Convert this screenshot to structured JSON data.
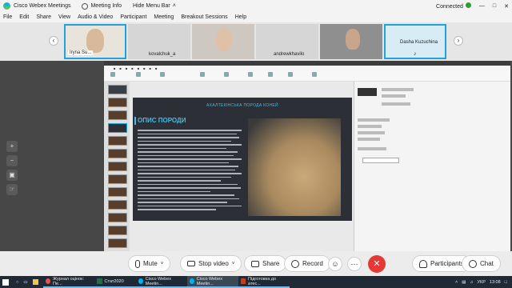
{
  "titlebar": {
    "app_title": "Cisco Webex Meetings",
    "meeting_info": "Meeting Info",
    "hide_menu_bar": "Hide Menu Bar",
    "status": "Connected"
  },
  "menu": [
    "File",
    "Edit",
    "Share",
    "View",
    "Audio & Video",
    "Participant",
    "Meeting",
    "Breakout Sessions",
    "Help"
  ],
  "participants": [
    {
      "name": "Iryna Su..."
    },
    {
      "name": "kovalchuk_a"
    },
    {
      "name": ""
    },
    {
      "name": "andrewkhavilo"
    },
    {
      "name": ""
    },
    {
      "name": "Dasha Kuzuchina"
    }
  ],
  "slide": {
    "title": "АХАЛТЕКІНСЬКА ПОРОДА КОНЕЙ",
    "heading": "ОПИС ПОРОДИ"
  },
  "controls": {
    "mute": "Mute",
    "stop_video": "Stop video",
    "share": "Share",
    "record": "Record",
    "participants": "Participants",
    "chat": "Chat"
  },
  "taskbar": {
    "apps": [
      {
        "label": "Журнал оцінок: Пе..."
      },
      {
        "label": "Стат2020"
      },
      {
        "label": "Cisco Webex Meetin..."
      },
      {
        "label": "Cisco Webex Meetin..."
      },
      {
        "label": "Підготовка до атес..."
      }
    ],
    "lang": "УКР",
    "time": "13:08"
  },
  "colors": {
    "accent": "#1ea3db",
    "end_call": "#e53935",
    "slide_bg": "#2c2f35",
    "slide_text": "#49b9e0"
  }
}
